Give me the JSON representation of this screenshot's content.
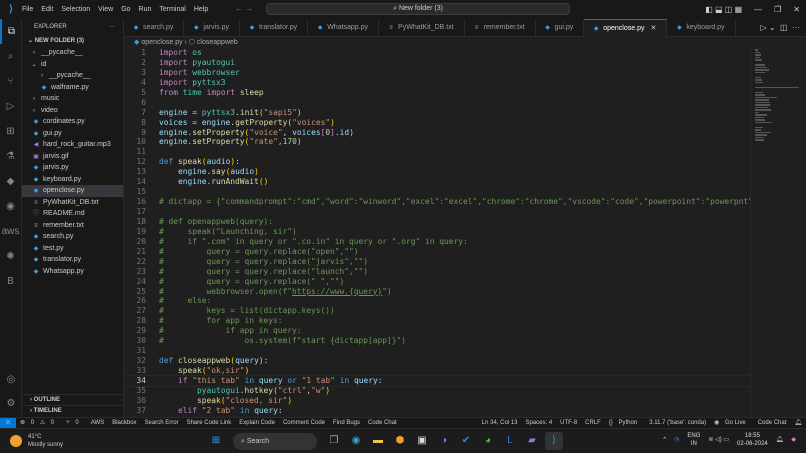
{
  "menu": [
    "File",
    "Edit",
    "Selection",
    "View",
    "Go",
    "Run",
    "Terminal",
    "Help"
  ],
  "command_center": "New folder (3)",
  "explorer": {
    "title": "EXPLORER",
    "folder": "NEW FOLDER (3)",
    "outline": "OUTLINE",
    "timeline": "TIMELINE",
    "items": [
      {
        "label": "__pycache__",
        "type": "folder",
        "indent": 1,
        "open": false
      },
      {
        "label": "id",
        "type": "folder",
        "indent": 1,
        "open": true
      },
      {
        "label": "__pycache__",
        "type": "folder",
        "indent": 2,
        "open": false
      },
      {
        "label": "walframe.py",
        "type": "py",
        "indent": 2
      },
      {
        "label": "music",
        "type": "folder",
        "indent": 1,
        "open": false
      },
      {
        "label": "video",
        "type": "folder",
        "indent": 1,
        "open": false
      },
      {
        "label": "cordinates.py",
        "type": "py",
        "indent": 1
      },
      {
        "label": "gui.py",
        "type": "py",
        "indent": 1
      },
      {
        "label": "hard_rock_guitar.mp3",
        "type": "mp3",
        "indent": 1
      },
      {
        "label": "jarvis.gif",
        "type": "gif",
        "indent": 1
      },
      {
        "label": "jarvis.py",
        "type": "py",
        "indent": 1
      },
      {
        "label": "keyboard.py",
        "type": "py",
        "indent": 1
      },
      {
        "label": "openclose.py",
        "type": "py",
        "indent": 1,
        "selected": true
      },
      {
        "label": "PyWhatKit_DB.txt",
        "type": "txt",
        "indent": 1
      },
      {
        "label": "README.md",
        "type": "md",
        "indent": 1
      },
      {
        "label": "remember.txt",
        "type": "txt",
        "indent": 1
      },
      {
        "label": "search.py",
        "type": "py",
        "indent": 1
      },
      {
        "label": "test.py",
        "type": "py",
        "indent": 1
      },
      {
        "label": "translator.py",
        "type": "py",
        "indent": 1
      },
      {
        "label": "Whatsapp.py",
        "type": "py",
        "indent": 1
      }
    ]
  },
  "tabs": [
    {
      "label": "search.py",
      "type": "py"
    },
    {
      "label": "jarvis.py",
      "type": "py"
    },
    {
      "label": "translator.py",
      "type": "py"
    },
    {
      "label": "Whatsapp.py",
      "type": "py"
    },
    {
      "label": "PyWhatKit_DB.txt",
      "type": "txt"
    },
    {
      "label": "remember.txt",
      "type": "txt"
    },
    {
      "label": "gui.py",
      "type": "py"
    },
    {
      "label": "openclose.py",
      "type": "py",
      "active": true
    },
    {
      "label": "keyboard.py",
      "type": "py"
    }
  ],
  "breadcrumb": {
    "file": "openclose.py",
    "symbol": "closeappweb"
  },
  "current_line": 34,
  "code": [
    [
      [
        "kw",
        "import"
      ],
      [
        "op",
        " "
      ],
      [
        "mod",
        "os"
      ]
    ],
    [
      [
        "kw",
        "import"
      ],
      [
        "op",
        " "
      ],
      [
        "mod",
        "pyautogui"
      ]
    ],
    [
      [
        "kw",
        "import"
      ],
      [
        "op",
        " "
      ],
      [
        "mod",
        "webbrowser"
      ]
    ],
    [
      [
        "kw",
        "import"
      ],
      [
        "op",
        " "
      ],
      [
        "mod",
        "pyttsx3"
      ]
    ],
    [
      [
        "kw",
        "from"
      ],
      [
        "op",
        " "
      ],
      [
        "mod",
        "time"
      ],
      [
        "op",
        " "
      ],
      [
        "kw",
        "import"
      ],
      [
        "op",
        " "
      ],
      [
        "fn",
        "sleep"
      ]
    ],
    [],
    [
      [
        "var",
        "engine"
      ],
      [
        "op",
        " = "
      ],
      [
        "mod",
        "pyttsx3"
      ],
      [
        "op",
        "."
      ],
      [
        "fn",
        "init"
      ],
      [
        "pa",
        "("
      ],
      [
        "str",
        "\"sapi5\""
      ],
      [
        "pa",
        ")"
      ]
    ],
    [
      [
        "var",
        "voices"
      ],
      [
        "op",
        " = "
      ],
      [
        "var",
        "engine"
      ],
      [
        "op",
        "."
      ],
      [
        "fn",
        "getProperty"
      ],
      [
        "pa",
        "("
      ],
      [
        "str",
        "\"voices\""
      ],
      [
        "pa",
        ")"
      ]
    ],
    [
      [
        "var",
        "engine"
      ],
      [
        "op",
        "."
      ],
      [
        "fn",
        "setProperty"
      ],
      [
        "pa",
        "("
      ],
      [
        "str",
        "\"voice\""
      ],
      [
        "op",
        ", "
      ],
      [
        "var",
        "voices"
      ],
      [
        "pb",
        "["
      ],
      [
        "num",
        "0"
      ],
      [
        "pb",
        "]"
      ],
      [
        "op",
        "."
      ],
      [
        "var",
        "id"
      ],
      [
        "pa",
        ")"
      ]
    ],
    [
      [
        "var",
        "engine"
      ],
      [
        "op",
        "."
      ],
      [
        "fn",
        "setProperty"
      ],
      [
        "pa",
        "("
      ],
      [
        "str",
        "\"rate\""
      ],
      [
        "op",
        ","
      ],
      [
        "num",
        "170"
      ],
      [
        "pa",
        ")"
      ]
    ],
    [],
    [
      [
        "def",
        "def"
      ],
      [
        "op",
        " "
      ],
      [
        "fn",
        "speak"
      ],
      [
        "pa",
        "("
      ],
      [
        "var",
        "audio"
      ],
      [
        "pa",
        ")"
      ],
      [
        "op",
        ":"
      ]
    ],
    [
      [
        "op",
        "    "
      ],
      [
        "var",
        "engine"
      ],
      [
        "op",
        "."
      ],
      [
        "fn",
        "say"
      ],
      [
        "pa",
        "("
      ],
      [
        "var",
        "audio"
      ],
      [
        "pa",
        ")"
      ]
    ],
    [
      [
        "op",
        "    "
      ],
      [
        "var",
        "engine"
      ],
      [
        "op",
        "."
      ],
      [
        "fn",
        "runAndWait"
      ],
      [
        "pa",
        "()"
      ]
    ],
    [],
    [
      [
        "cm",
        "# dictapp = {\"commandprompt\":\"cmd\",\"word\":\"winword\",\"excel\":\"excel\",\"chrome\":\"chrome\",\"vscode\":\"code\",\"powerpoint\":\"powerpnt\",\"edge\":\"msedge\",\"not"
      ]
    ],
    [],
    [
      [
        "cm",
        "# def openappweb(query):"
      ]
    ],
    [
      [
        "cm",
        "#     speak(\"Launching, sir\")"
      ]
    ],
    [
      [
        "cm",
        "#     if \".com\" in query or \".co.in\" in query or \".org\" in query:"
      ]
    ],
    [
      [
        "cm",
        "#         query = query.replace(\"open\",\"\")"
      ]
    ],
    [
      [
        "cm",
        "#         query = query.replace(\"jarvis\",\"\")"
      ]
    ],
    [
      [
        "cm",
        "#         query = query.replace(\"launch\",\"\")"
      ]
    ],
    [
      [
        "cm",
        "#         query = query.replace(\" \",\"\")"
      ]
    ],
    [
      [
        "cm",
        "#         webbrowser.open(f\""
      ],
      [
        "cmu",
        "https://www.{query}"
      ],
      [
        "cm",
        "\")"
      ]
    ],
    [
      [
        "cm",
        "#     else:"
      ]
    ],
    [
      [
        "cm",
        "#         keys = list(dictapp.keys())"
      ]
    ],
    [
      [
        "cm",
        "#         for app in keys:"
      ]
    ],
    [
      [
        "cm",
        "#             if app in query:"
      ]
    ],
    [
      [
        "cm",
        "#                 os.system(f\"start {dictapp[app]}\")"
      ]
    ],
    [],
    [
      [
        "def",
        "def"
      ],
      [
        "op",
        " "
      ],
      [
        "fn",
        "closeappweb"
      ],
      [
        "pa",
        "("
      ],
      [
        "var",
        "query"
      ],
      [
        "pa",
        ")"
      ],
      [
        "op",
        ":"
      ]
    ],
    [
      [
        "op",
        "    "
      ],
      [
        "fn",
        "speak"
      ],
      [
        "pa",
        "("
      ],
      [
        "str",
        "\"ok,sir\""
      ],
      [
        "pa",
        ")"
      ]
    ],
    [
      [
        "op",
        "    "
      ],
      [
        "kw",
        "if"
      ],
      [
        "op",
        " "
      ],
      [
        "str",
        "\"this tab\""
      ],
      [
        "op",
        " "
      ],
      [
        "def",
        "in"
      ],
      [
        "op",
        " "
      ],
      [
        "var",
        "query"
      ],
      [
        "op",
        " "
      ],
      [
        "def",
        "or"
      ],
      [
        "op",
        " "
      ],
      [
        "str",
        "\"1 tab\""
      ],
      [
        "op",
        " "
      ],
      [
        "def",
        "in"
      ],
      [
        "op",
        " "
      ],
      [
        "var",
        "query"
      ],
      [
        "op",
        ":"
      ]
    ],
    [
      [
        "op",
        "        "
      ],
      [
        "mod",
        "pyautogui"
      ],
      [
        "op",
        "."
      ],
      [
        "fn",
        "hotkey"
      ],
      [
        "pa",
        "("
      ],
      [
        "str",
        "\"ctrl\""
      ],
      [
        "op",
        ","
      ],
      [
        "str",
        "\"w\""
      ],
      [
        "pa",
        ")"
      ]
    ],
    [
      [
        "op",
        "        "
      ],
      [
        "fn",
        "speak"
      ],
      [
        "pa",
        "("
      ],
      [
        "str",
        "\"closed, sir\""
      ],
      [
        "pa",
        ")"
      ]
    ],
    [
      [
        "op",
        "    "
      ],
      [
        "kw",
        "elif"
      ],
      [
        "op",
        " "
      ],
      [
        "str",
        "\"2 tab\""
      ],
      [
        "op",
        " "
      ],
      [
        "def",
        "in"
      ],
      [
        "op",
        " "
      ],
      [
        "var",
        "query"
      ],
      [
        "op",
        ":"
      ]
    ]
  ],
  "status": {
    "errors": "0",
    "warnings": "0",
    "ports": "0",
    "left": [
      "AWS",
      "Blackbox",
      "Search Error",
      "Share Code Link",
      "Explain Code",
      "Comment Code",
      "Find Bugs",
      "Code Chat"
    ],
    "position": "Ln 34, Col 13",
    "spaces": "Spaces: 4",
    "encoding": "UTF-8",
    "eol": "CRLF",
    "language": "Python",
    "interpreter": "3.11.7 ('base': conda)",
    "golive": "Go Live",
    "codechat": "Code Chat"
  },
  "taskbar": {
    "temp": "41°C",
    "weather": "Mostly sunny",
    "search": "Search",
    "lang1": "ENG",
    "lang2": "IN",
    "time": "18:55",
    "date": "02-06-2024"
  }
}
